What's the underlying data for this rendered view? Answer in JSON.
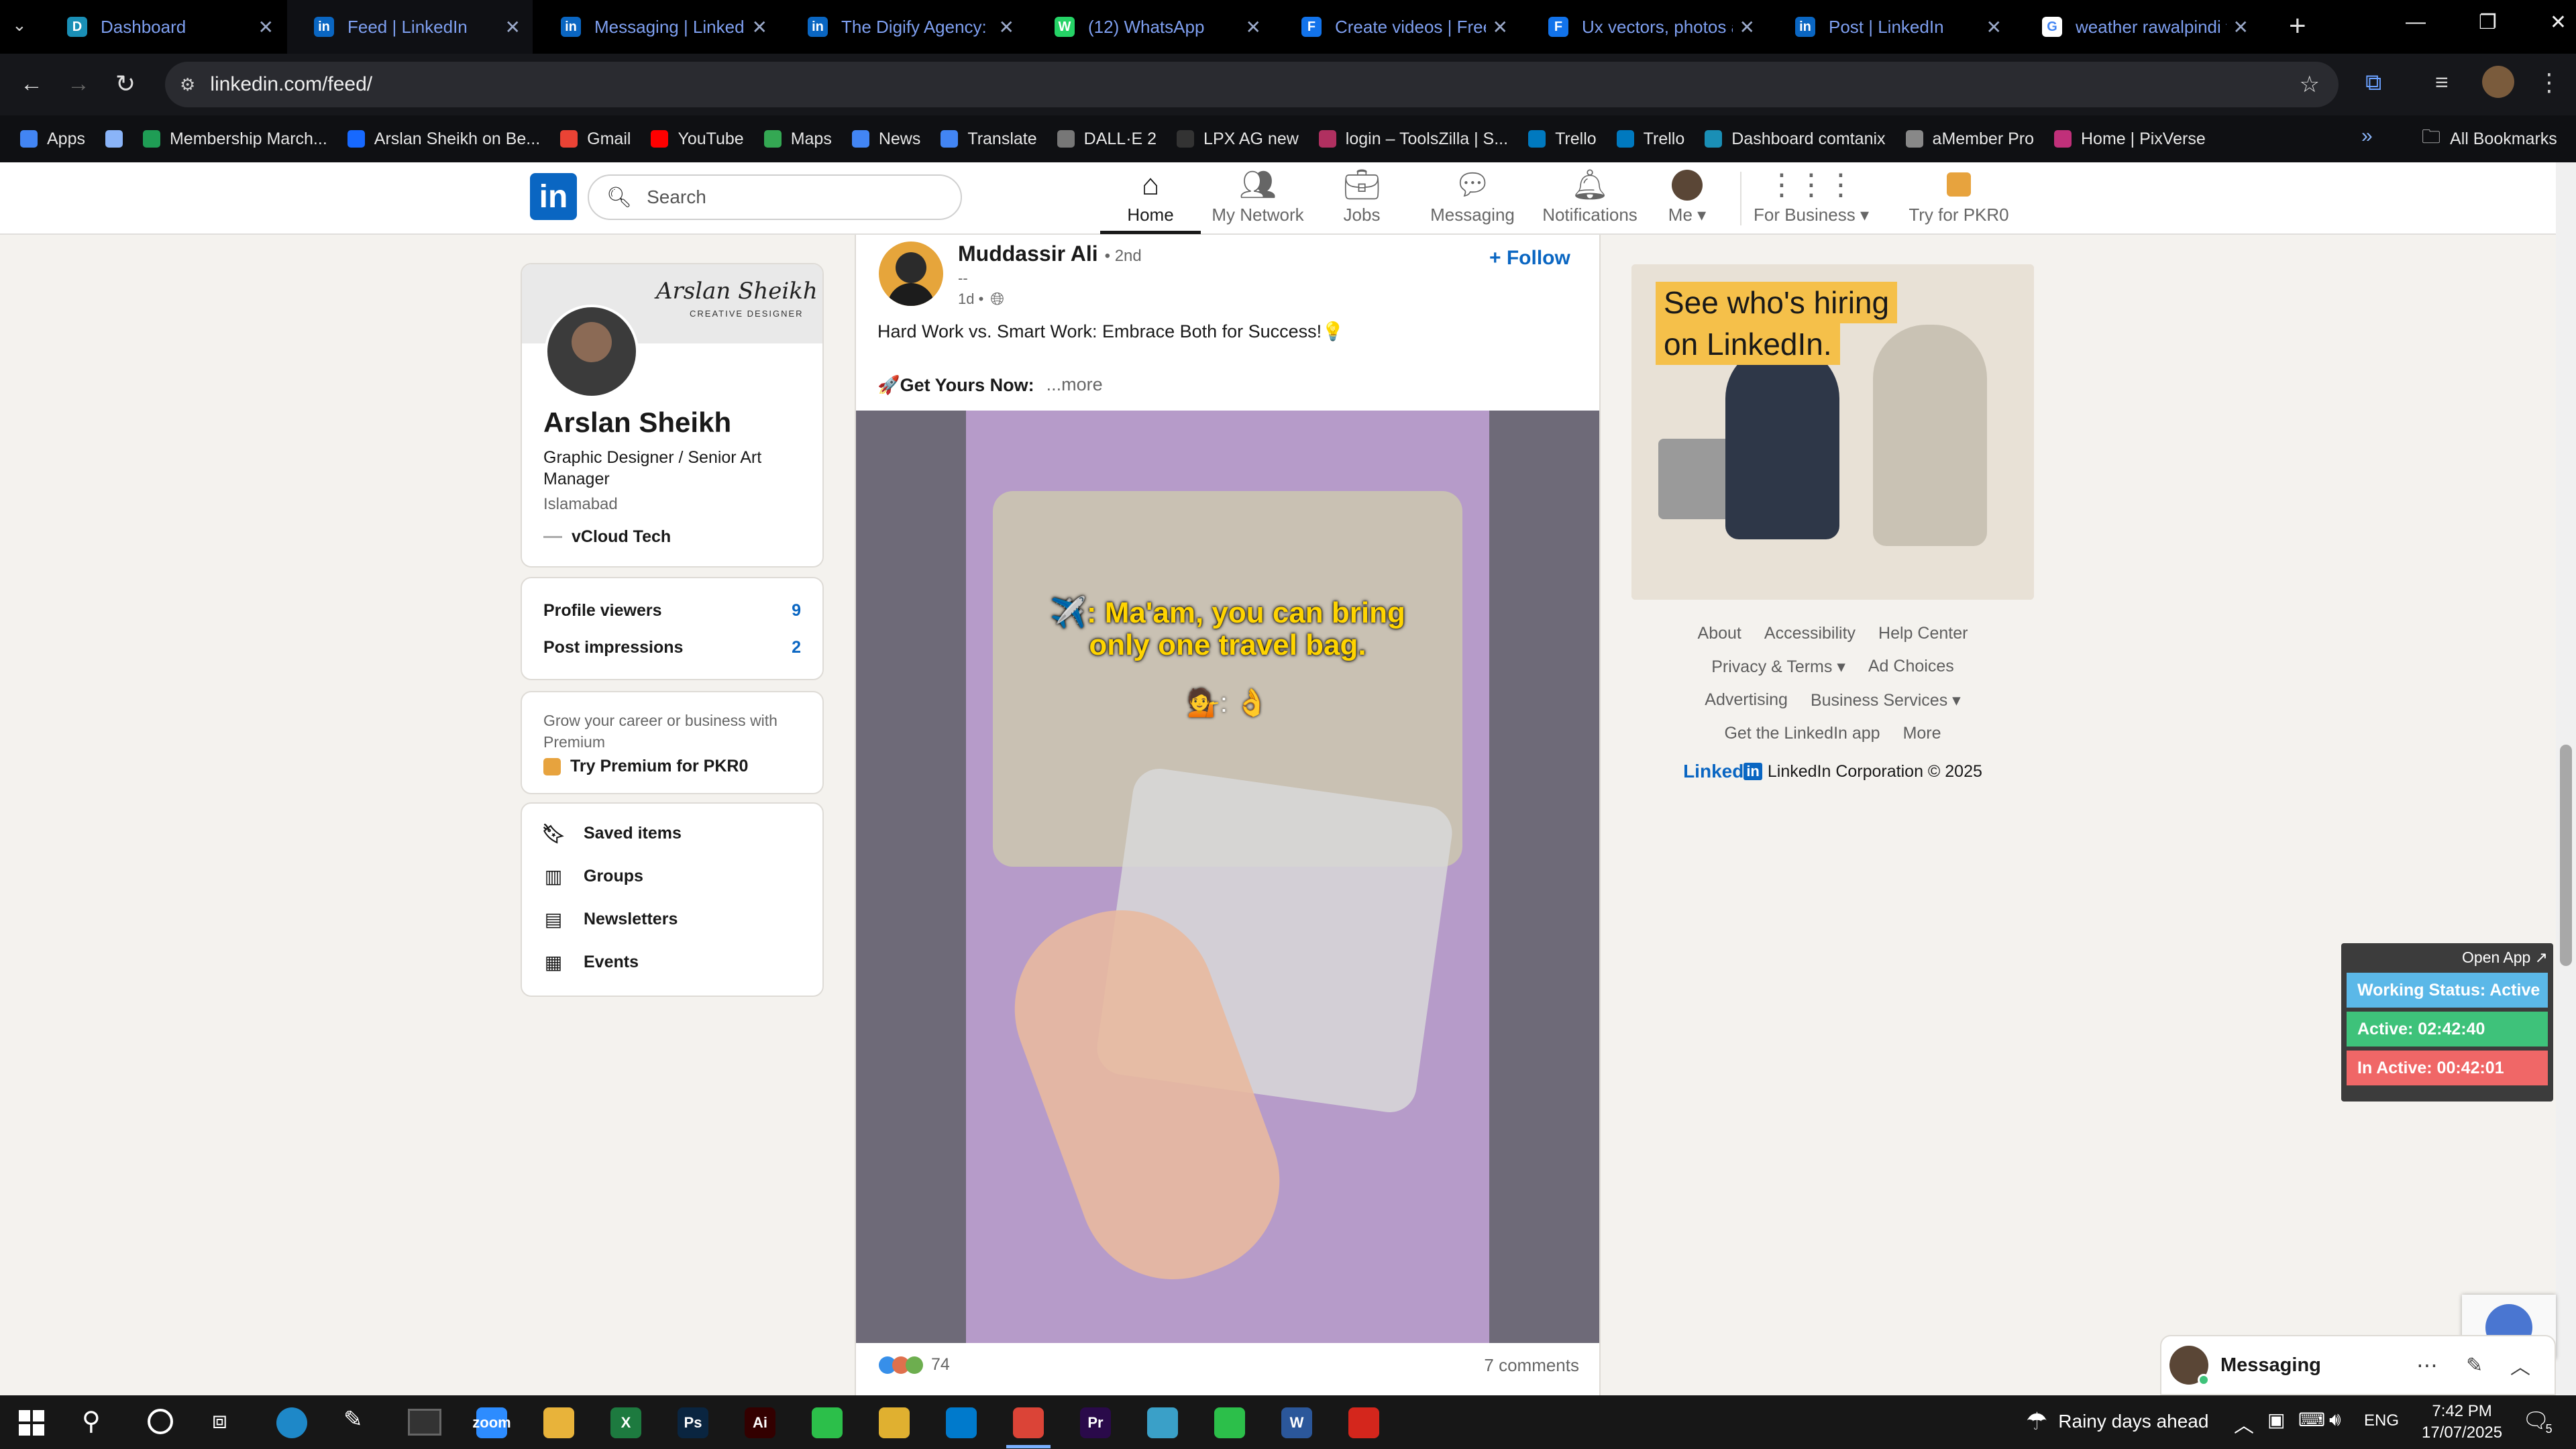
{
  "browser": {
    "tabs": [
      {
        "title": "Dashboard",
        "icon_color": "#1a8fb6",
        "icon": "D"
      },
      {
        "title": "Feed | LinkedIn",
        "icon_color": "#0a66c2",
        "icon": "in"
      },
      {
        "title": "Messaging | LinkedIn",
        "icon_color": "#0a66c2",
        "icon": "in"
      },
      {
        "title": "The Digify Agency: O",
        "icon_color": "#0a66c2",
        "icon": "in"
      },
      {
        "title": "(12) WhatsApp",
        "icon_color": "#25d366",
        "icon": "W"
      },
      {
        "title": "Create videos | Freep",
        "icon_color": "#1273eb",
        "icon": "F"
      },
      {
        "title": "Ux vectors, photos an",
        "icon_color": "#1273eb",
        "icon": "F"
      },
      {
        "title": "Post | LinkedIn",
        "icon_color": "#0a66c2",
        "icon": "in"
      },
      {
        "title": "weather rawalpindi to",
        "icon_color": "#ffffff",
        "icon": "G"
      }
    ],
    "url": "linkedin.com/feed/",
    "bookmarks": [
      {
        "label": "Apps",
        "color": "#4285f4"
      },
      {
        "label": "",
        "color": "#8ab4f8"
      },
      {
        "label": "Membership March...",
        "color": "#1f9d55"
      },
      {
        "label": "Arslan Sheikh on Be...",
        "color": "#1769ff"
      },
      {
        "label": "Gmail",
        "color": "#ea4335"
      },
      {
        "label": "YouTube",
        "color": "#ff0000"
      },
      {
        "label": "Maps",
        "color": "#34a853"
      },
      {
        "label": "News",
        "color": "#4285f4"
      },
      {
        "label": "Translate",
        "color": "#4285f4"
      },
      {
        "label": "DALL·E 2",
        "color": "#777777"
      },
      {
        "label": "LPX AG new",
        "color": "#333333"
      },
      {
        "label": "login – ToolsZilla | S...",
        "color": "#b03060"
      },
      {
        "label": "Trello",
        "color": "#0079bf"
      },
      {
        "label": "Trello",
        "color": "#0079bf"
      },
      {
        "label": "Dashboard comtanix",
        "color": "#1a8fb6"
      },
      {
        "label": "aMember Pro",
        "color": "#888888"
      },
      {
        "label": "Home | PixVerse",
        "color": "#c0307a"
      }
    ],
    "all_bookmarks": "All Bookmarks"
  },
  "linkedin_nav": {
    "search_placeholder": "Search",
    "items": [
      {
        "label": "Home",
        "icon": "home-icon"
      },
      {
        "label": "My Network",
        "icon": "network-icon"
      },
      {
        "label": "Jobs",
        "icon": "briefcase-icon"
      },
      {
        "label": "Messaging",
        "icon": "chat-icon"
      },
      {
        "label": "Notifications",
        "icon": "bell-icon"
      },
      {
        "label": "Me",
        "icon": "avatar"
      }
    ],
    "for_business": "For Business",
    "premium": "Try for PKR0"
  },
  "profile": {
    "name": "Arslan Sheikh",
    "headline": "Graphic Designer / Senior Art Manager",
    "location": "Islamabad",
    "company": "vCloud Tech",
    "banner_text": "Arslan Sheikh",
    "banner_sub": "CREATIVE DESIGNER"
  },
  "stats": [
    {
      "label": "Profile viewers",
      "value": "9"
    },
    {
      "label": "Post impressions",
      "value": "2"
    }
  ],
  "premium_card": {
    "text": "Grow your career or business with Premium",
    "link": "Try Premium for PKR0"
  },
  "side_links": [
    {
      "label": "Saved items",
      "icon": "bookmark-icon"
    },
    {
      "label": "Groups",
      "icon": "groups-icon"
    },
    {
      "label": "Newsletters",
      "icon": "newsletter-icon"
    },
    {
      "label": "Events",
      "icon": "calendar-icon"
    }
  ],
  "post": {
    "author": "Muddassir Ali",
    "degree": "• 2nd",
    "subtitle": "--",
    "time": "1d •",
    "follow": "+ Follow",
    "text": "Hard Work vs. Smart Work: Embrace Both for Success!💡",
    "cta": "🚀Get Yours Now:",
    "more": "...more",
    "video_caption_1": "✈️: Ma'am, you can bring",
    "video_caption_2": "only one travel bag.",
    "video_emoji": "💁: 👌",
    "reactions": "74",
    "comments": "7 comments"
  },
  "ad": {
    "line1": "See who's hiring",
    "line2": "on LinkedIn."
  },
  "footer": {
    "links_row1": [
      "About",
      "Accessibility",
      "Help Center"
    ],
    "links_row2": [
      "Privacy & Terms ▾",
      "Ad Choices"
    ],
    "links_row3": [
      "Advertising",
      "Business Services ▾"
    ],
    "links_row4": [
      "Get the LinkedIn app",
      "More"
    ],
    "brand": "Linked",
    "copyright": "LinkedIn Corporation © 2025"
  },
  "tracker": {
    "open_app": "Open App ↗",
    "working": "Working Status: Active",
    "active": "Active: 02:42:40",
    "inactive": "In Active: 00:42:01"
  },
  "messaging": {
    "label": "Messaging"
  },
  "taskbar": {
    "weather": "Rainy days ahead",
    "lang": "ENG",
    "time": "7:42 PM",
    "date": "17/07/2025",
    "notif_count": "5",
    "apps": [
      {
        "name": "zoom",
        "color": "#2d8cff",
        "label": "zoom"
      },
      {
        "name": "files",
        "color": "#e8b33a",
        "label": ""
      },
      {
        "name": "excel",
        "color": "#1d7a3f",
        "label": "X"
      },
      {
        "name": "photoshop",
        "color": "#0a2540",
        "label": "Ps"
      },
      {
        "name": "illustrator",
        "color": "#330000",
        "label": "Ai"
      },
      {
        "name": "green-app",
        "color": "#2cbf4a",
        "label": ""
      },
      {
        "name": "chrome",
        "color": "#e0b030",
        "label": ""
      },
      {
        "name": "vscode",
        "color": "#007acc",
        "label": ""
      },
      {
        "name": "chrome-active",
        "color": "#db4437",
        "label": ""
      },
      {
        "name": "premiere",
        "color": "#2a0a4a",
        "label": "Pr"
      },
      {
        "name": "app-blue",
        "color": "#3aa0c8",
        "label": ""
      },
      {
        "name": "app-green",
        "color": "#2cbf4a",
        "label": ""
      },
      {
        "name": "word",
        "color": "#2b579a",
        "label": "W"
      },
      {
        "name": "acrobat",
        "color": "#d4261c",
        "label": ""
      }
    ]
  }
}
